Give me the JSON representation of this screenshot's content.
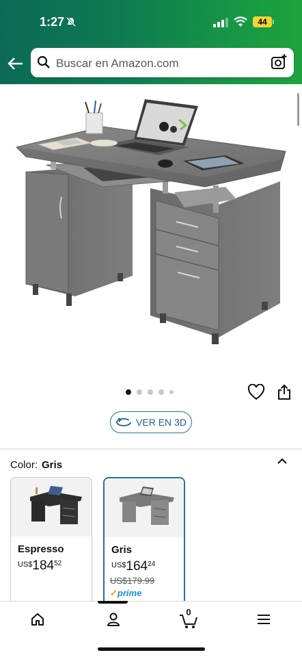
{
  "status_bar": {
    "time": "1:27",
    "battery": "44"
  },
  "search": {
    "placeholder": "Buscar en Amazon.com"
  },
  "gallery": {
    "dots": 5,
    "active_index": 0
  },
  "view_3d": {
    "label": "VER EN 3D"
  },
  "color_selector": {
    "label": "Color:",
    "selected": "Gris",
    "options": [
      {
        "name": "Espresso",
        "currency": "US$",
        "whole": "184",
        "fraction": "52"
      },
      {
        "name": "Gris",
        "currency": "US$",
        "whole": "164",
        "fraction": "24",
        "old_price": "US$179.99",
        "prime": "prime"
      }
    ]
  },
  "bottom_nav": {
    "cart_count": "0"
  },
  "colors": {
    "accent": "#2a6f97",
    "header_start": "#0b6a55",
    "header_end": "#1ea33c",
    "prime": "#1c8fd6"
  }
}
